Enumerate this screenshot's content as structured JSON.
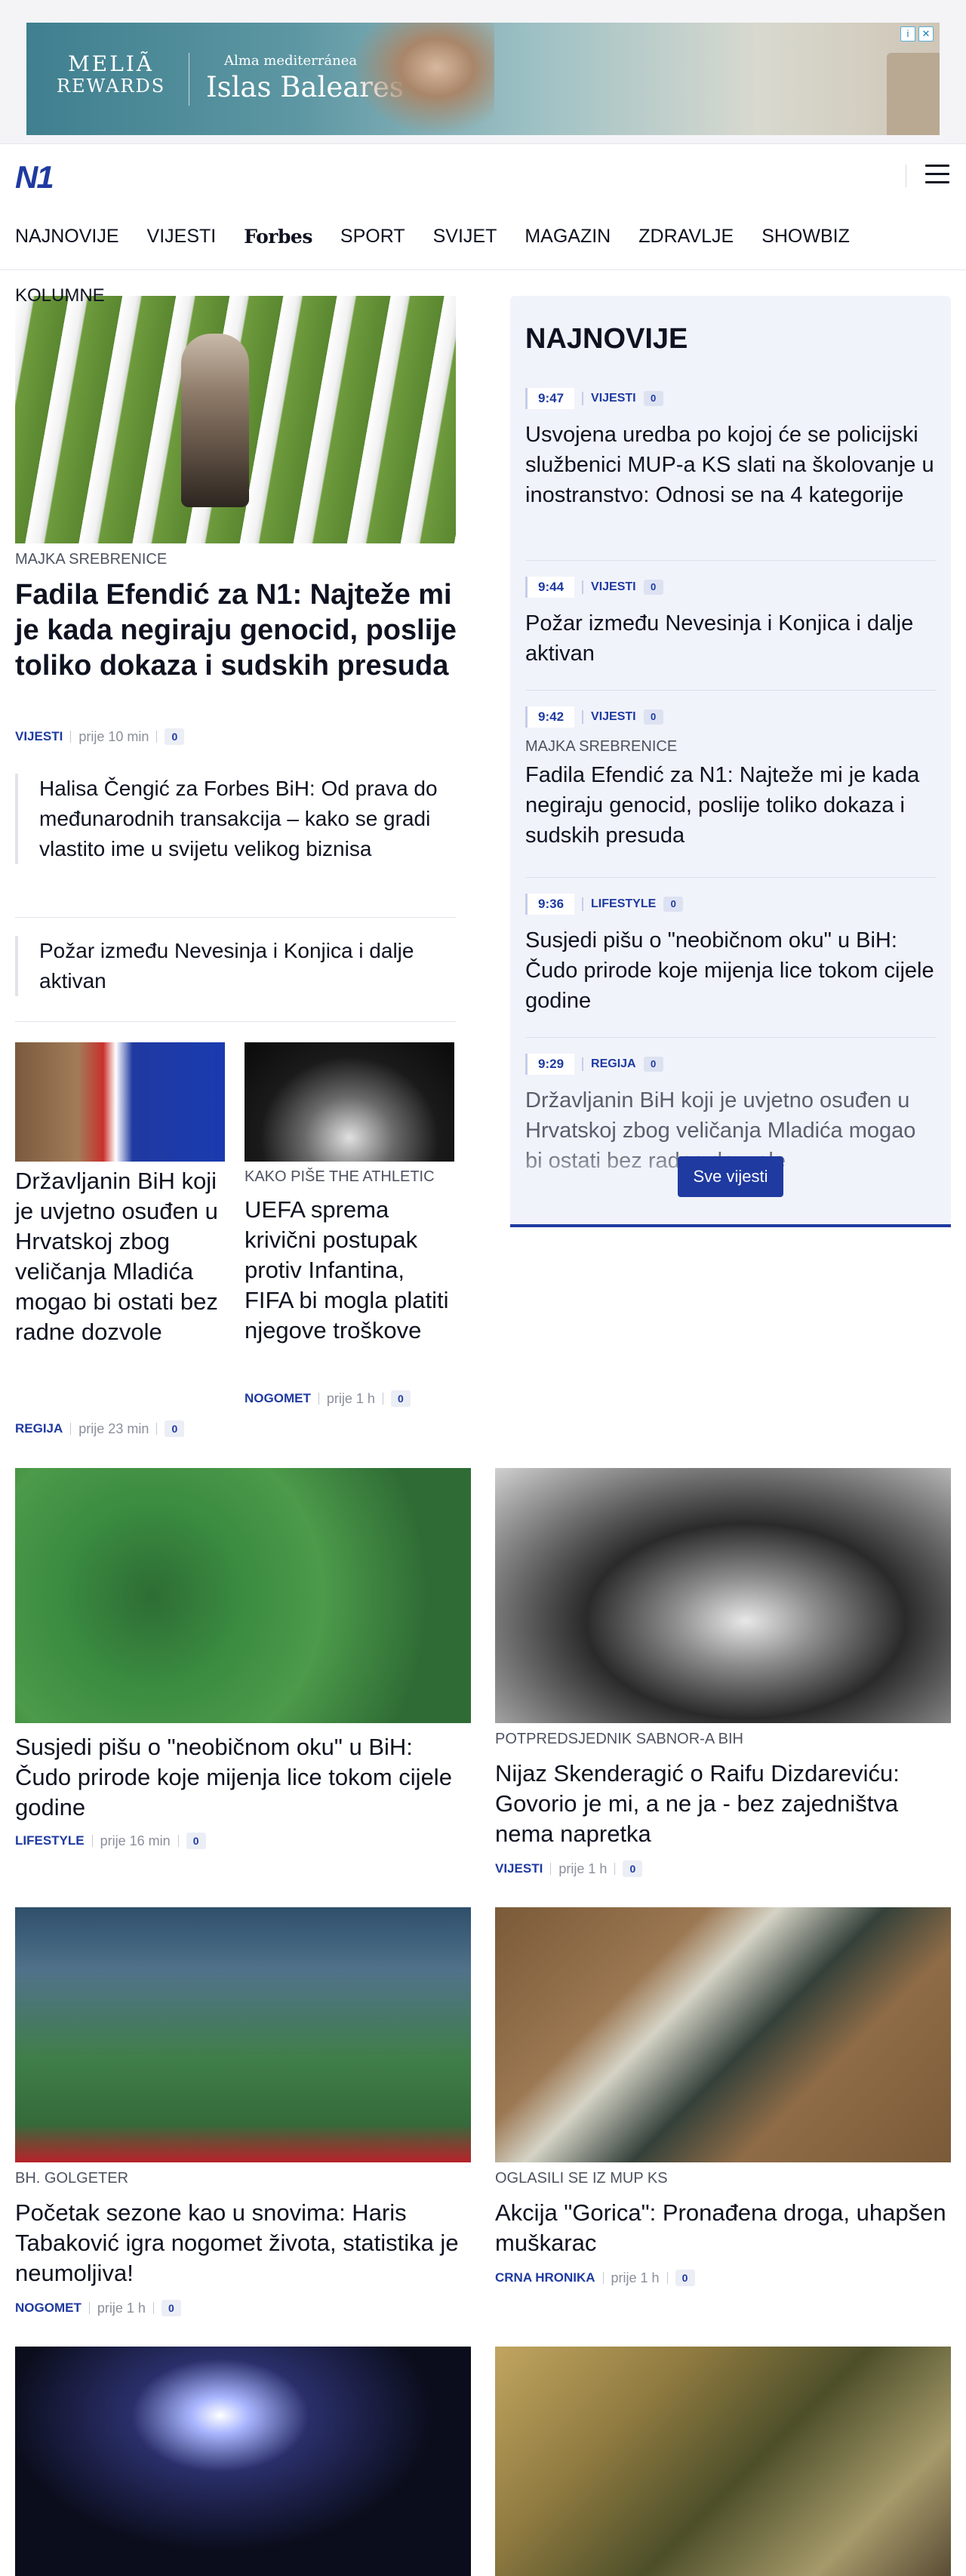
{
  "ad": {
    "brand_line1": "MELIÃ",
    "brand_line2": "REWARDS",
    "tagline": "Alma mediterránea",
    "headline": "Islas Baleares",
    "badge_info": "i",
    "badge_close": "✕"
  },
  "header": {
    "logo": "N1",
    "menu_icon": "hamburger-icon"
  },
  "nav": {
    "items": [
      "NAJNOVIJE",
      "VIJESTI",
      "Forbes",
      "SPORT",
      "SVIJET",
      "MAGAZIN",
      "ZDRAVLJE",
      "SHOWBIZ"
    ]
  },
  "main": {
    "section_label": "KOLUMNE",
    "hero": {
      "kicker": "MAJKA SREBRENICE",
      "title": "Fadila Efendić za N1: Najteže mi je kada negiraju genocid, poslije toliko dokaza i sudskih presuda",
      "category": "VIJESTI",
      "time": "prije 10 min",
      "comments": "0"
    },
    "related": [
      "Halisa Čengić za Forbes BiH: Od prava do međunarodnih transakcija – kako se gradi vlastito ime u svijetu velikog biznisa",
      "Požar između Nevesinja i Konjica i dalje aktivan"
    ],
    "small_cards": [
      {
        "kicker": "",
        "title": "Državljanin BiH koji je uvjetno osuđen u Hrvatskoj zbog veličanja Mladića mogao bi ostati bez radne dozvole",
        "category": "REGIJA",
        "time": "prije 23 min",
        "comments": "0"
      },
      {
        "kicker": "KAKO PIŠE THE ATHLETIC",
        "title": "UEFA sprema krivični postupak protiv Infantina, FIFA bi mogla platiti njegove troškove",
        "category": "NOGOMET",
        "time": "prije 1 h",
        "comments": "0"
      }
    ],
    "grid": [
      {
        "kicker": "",
        "title": "Susjedi pišu o \"neobičnom oku\" u BiH: Čudo prirode koje mijenja lice tokom cijele godine",
        "category": "LIFESTYLE",
        "time": "prije 16 min",
        "comments": "0"
      },
      {
        "kicker": "POTPREDSJEDNIK SABNOR-A BIH",
        "title": "Nijaz Skenderagić o Raifu Dizdareviću: Govorio je mi, a ne ja - bez zajedništva nema napretka",
        "category": "VIJESTI",
        "time": "prije 1 h",
        "comments": "0"
      },
      {
        "kicker": "BH. GOLGETER",
        "title": "Početak sezone kao u snovima: Haris Tabaković igra nogomet života, statistika je neumoljiva!",
        "category": "NOGOMET",
        "time": "prije 1 h",
        "comments": "0"
      },
      {
        "kicker": "OGLASILI SE IZ MUP KS",
        "title": "Akcija \"Gorica\": Pronađena droga, uhapšen muškarac",
        "category": "CRNA HRONIKA",
        "time": "prije 1 h",
        "comments": "0"
      }
    ]
  },
  "sidebar": {
    "title": "NAJNOVIJE",
    "items": [
      {
        "time": "9:47",
        "category": "VIJESTI",
        "comments": "0",
        "kicker": "",
        "title": "Usvojena uredba po kojoj će se policijski službenici MUP-a KS slati na školovanje u inostranstvo: Odnosi se na 4 kategorije"
      },
      {
        "time": "9:44",
        "category": "VIJESTI",
        "comments": "0",
        "kicker": "",
        "title": "Požar između Nevesinja i Konjica i dalje aktivan"
      },
      {
        "time": "9:42",
        "category": "VIJESTI",
        "comments": "0",
        "kicker": "MAJKA SREBRENICE",
        "title": "Fadila Efendić za N1: Najteže mi je kada negiraju genocid, poslije toliko dokaza i sudskih presuda"
      },
      {
        "time": "9:36",
        "category": "LIFESTYLE",
        "comments": "0",
        "kicker": "",
        "title": "Susjedi pišu o \"neobičnom oku\" u BiH: Čudo prirode koje mijenja lice tokom cijele godine"
      },
      {
        "time": "9:29",
        "category": "REGIJA",
        "comments": "0",
        "kicker": "",
        "title": "Državljanin BiH koji je uvjetno osuđen u Hrvatskoj zbog veličanja Mladića mogao bi ostati bez radne dozvole"
      }
    ],
    "button": "Sve vijesti"
  }
}
